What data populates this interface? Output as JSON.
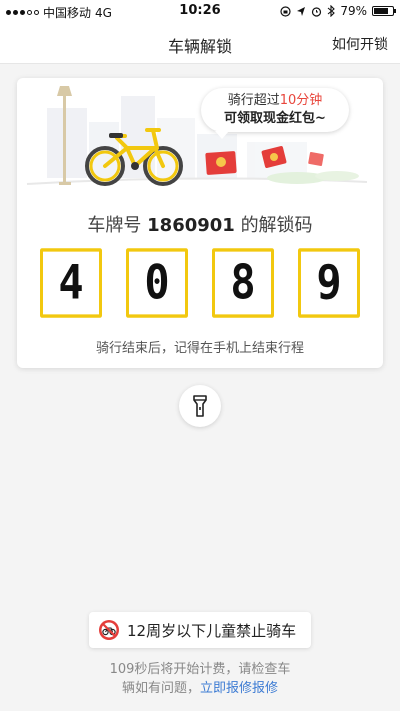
{
  "status_bar": {
    "carrier": "中国移动",
    "network": "4G",
    "time": "10:26",
    "battery": "79%",
    "battery_level": 0.79
  },
  "nav": {
    "title": "车辆解锁",
    "help": "如何开锁"
  },
  "card": {
    "bubble_line1_prefix": "骑行超过",
    "bubble_line1_highlight": "10分钟",
    "bubble_line2": "可领取现金红包~",
    "plate_prefix": "车牌号",
    "plate_number": "1860901",
    "plate_suffix": "的解锁码",
    "code": [
      "4",
      "0",
      "8",
      "9"
    ],
    "hint": "骑行结束后，记得在手机上结束行程"
  },
  "bottom": {
    "notice": "12周岁以下儿童禁止骑车",
    "footer_line1": "109秒后将开始计费，请检查车",
    "footer_line2_prefix": "辆如有问题，",
    "footer_link": "立即报修报修"
  },
  "colors": {
    "accent": "#f2c80f",
    "highlight": "#e8463c",
    "link": "#3c7bd3"
  },
  "icons": [
    "signal-icon",
    "location-icon",
    "alarm-icon",
    "bluetooth-icon",
    "battery-icon",
    "bicycle-icon",
    "red-envelope-icon",
    "flashlight-icon",
    "no-bicycle-icon"
  ]
}
